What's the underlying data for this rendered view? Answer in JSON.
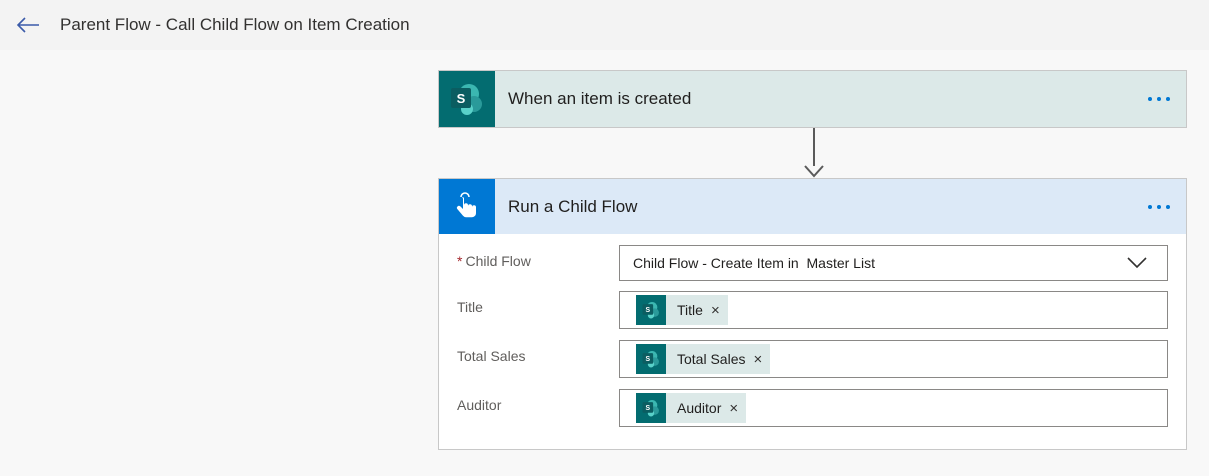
{
  "header": {
    "title": "Parent Flow - Call Child Flow on Item Creation"
  },
  "trigger": {
    "title": "When an item is created",
    "icon": "sharepoint-icon"
  },
  "action": {
    "title": "Run a Child Flow",
    "icon": "touch-hand-icon",
    "fields": {
      "child_flow": {
        "required_marker": "*",
        "label": "Child Flow",
        "value": "Child Flow - Create Item in  Master List"
      },
      "title": {
        "label": "Title",
        "token": "Title"
      },
      "total_sales": {
        "label": "Total Sales",
        "token": "Total Sales"
      },
      "auditor": {
        "label": "Auditor",
        "token": "Auditor"
      }
    },
    "token_remove_glyph": "×"
  },
  "colors": {
    "sharepoint": "#036c70",
    "action_blue": "#0078d4",
    "more_dots": "#0078d4"
  }
}
